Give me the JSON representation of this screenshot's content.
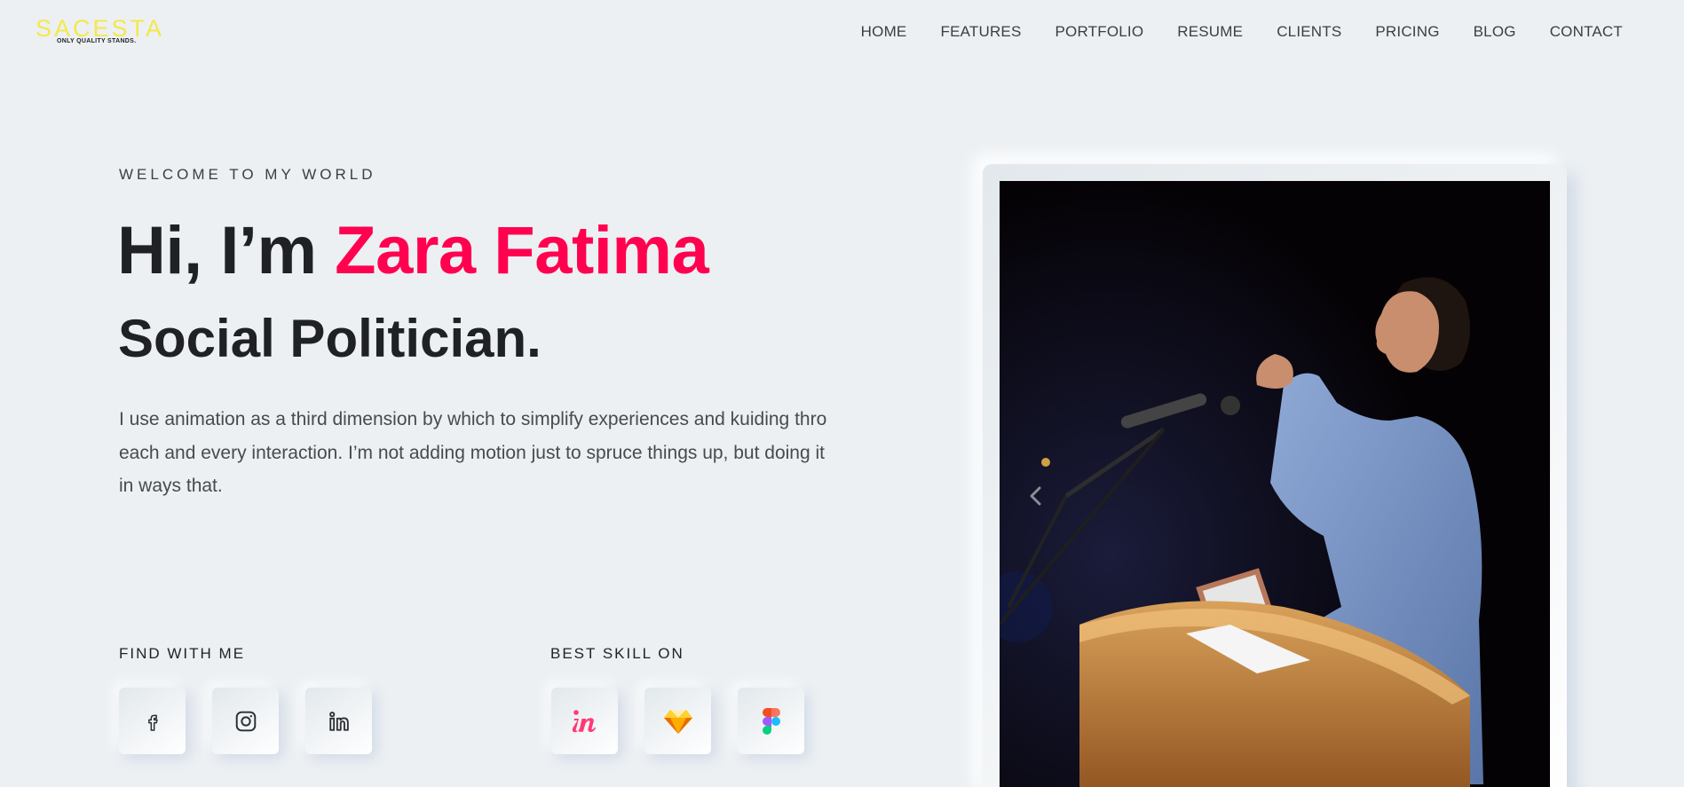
{
  "brand": {
    "logo_text": "SACESTA",
    "tagline": "ONLY QUALITY STANDS."
  },
  "nav": {
    "items": [
      "HOME",
      "FEATURES",
      "PORTFOLIO",
      "RESUME",
      "CLIENTS",
      "PRICING",
      "BLOG",
      "CONTACT"
    ]
  },
  "hero": {
    "welcome": "WELCOME TO MY WORLD",
    "greeting": "Hi, I’m ",
    "name": "Zara Fatima",
    "role": "Social Politician.",
    "intro": "I use animation as a third dimension by which to simplify experiences and kuiding thro each and every interaction. I’m not adding motion just to spruce things up, but doing it in ways that."
  },
  "social": {
    "title": "FIND WITH ME",
    "icons": [
      "facebook-icon",
      "instagram-icon",
      "linkedin-icon"
    ]
  },
  "skills": {
    "title": "BEST SKILL ON",
    "icons": [
      "invision-icon",
      "sketch-icon",
      "figma-icon"
    ]
  },
  "colors": {
    "background": "#ecf0f3",
    "accent": "#ff014f",
    "heading": "#1f2125",
    "logo": "#f4e84a"
  },
  "slider": {
    "prev_icon": "chevron-left-icon"
  }
}
